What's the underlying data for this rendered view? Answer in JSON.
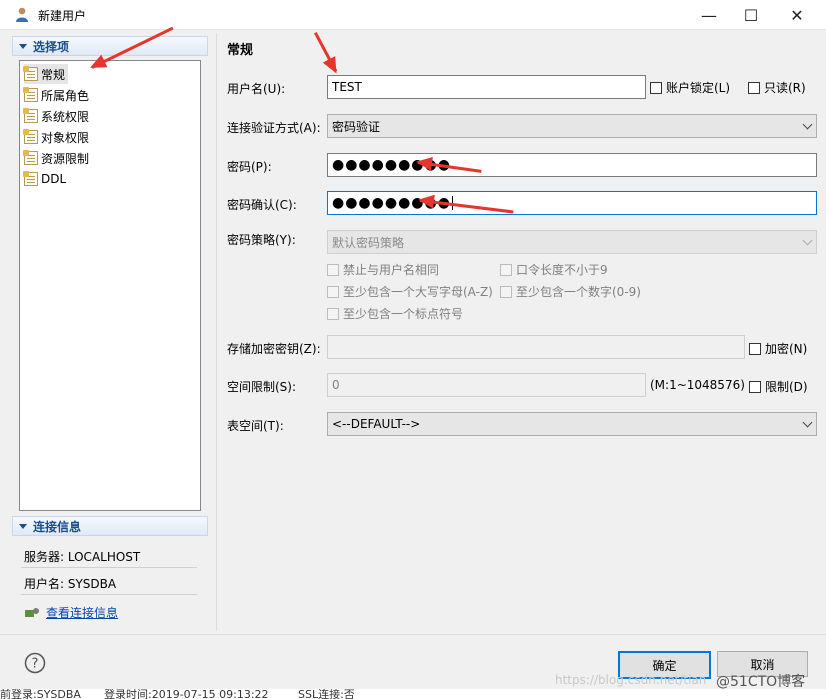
{
  "window": {
    "title": "新建用户",
    "icons": {
      "app": "user-icon",
      "min": "minimize-icon",
      "max": "maximize-icon",
      "close": "close-icon"
    }
  },
  "sidebar": {
    "section_title": "选择项",
    "items": [
      {
        "label": "常规",
        "selected": true
      },
      {
        "label": "所属角色"
      },
      {
        "label": "系统权限"
      },
      {
        "label": "对象权限"
      },
      {
        "label": "资源限制"
      },
      {
        "label": "DDL"
      }
    ]
  },
  "connection": {
    "section_title": "连接信息",
    "server": "服务器: LOCALHOST",
    "user": "用户名: SYSDBA",
    "view_link": "查看连接信息"
  },
  "form": {
    "heading": "常规",
    "username_label": "用户名(U):",
    "username_value": "TEST",
    "lock_label": "账户锁定(L)",
    "readonly_label": "只读(R)",
    "auth_label": "连接验证方式(A):",
    "auth_value": "密码验证",
    "password_label": "密码(P):",
    "password_value": "●●●●●●●●●",
    "confirm_label": "密码确认(C):",
    "confirm_value": "●●●●●●●●●",
    "policy_label": "密码策略(Y):",
    "policy_value": "默认密码策略",
    "policy_options": {
      "same_name": "禁止与用户名相同",
      "min_length": "口令长度不小于9",
      "upper": "至少包含一个大写字母(A-Z)",
      "digit": "至少包含一个数字(0-9)",
      "punct": "至少包含一个标点符号"
    },
    "key_label": "存储加密密钥(Z):",
    "encrypt_label": "加密(N)",
    "space_label": "空间限制(S):",
    "space_value": "0",
    "space_range": "(M:1~1048576)",
    "limit_label": "限制(D)",
    "tablespace_label": "表空间(T):",
    "tablespace_value": "<--DEFAULT-->"
  },
  "buttons": {
    "ok": "确定",
    "cancel": "取消",
    "help_icon": "help-icon"
  },
  "statusbar": {
    "login": "前登录:SYSDBA",
    "time": "登录时间:2019-07-15 09:13:22",
    "ssl": "SSL连接:否"
  },
  "watermark": "https://blog.csdn.net/tian",
  "logo": "@51CTO博客",
  "colors": {
    "accent": "#0078d7",
    "section_text": "#1b4d8c",
    "annotation_arrow": "#e5352d"
  }
}
